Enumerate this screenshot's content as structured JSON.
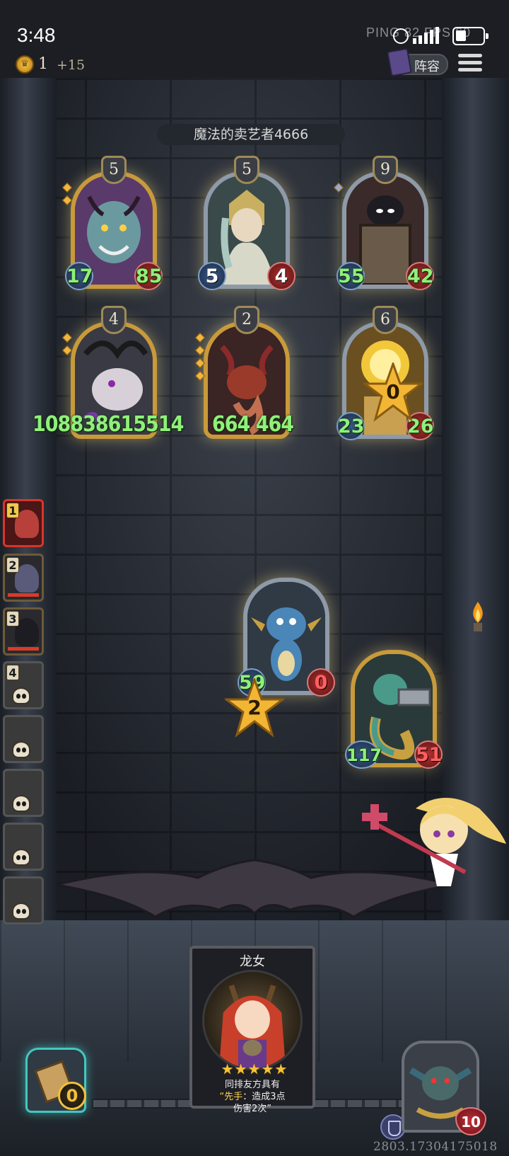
{
  "status_bar": {
    "time": "3:48",
    "ping": "PING 82  FPS 60"
  },
  "top_hud": {
    "coins": "1",
    "coin_income": "+15",
    "lineup_label": "阵容"
  },
  "opponent": {
    "name": "魔法的卖艺者4666"
  },
  "enemy_board": [
    {
      "tier": "5",
      "attack": "17",
      "health": "85",
      "attack_color": "green",
      "health_color": "green",
      "frame": "gold",
      "art": "demon-icon"
    },
    {
      "tier": "5",
      "attack": "5",
      "health": "4",
      "attack_color": "white",
      "health_color": "white",
      "frame": "silver",
      "art": "priest-icon"
    },
    {
      "tier": "9",
      "attack": "55",
      "health": "42",
      "attack_color": "green",
      "health_color": "green",
      "frame": "silver",
      "art": "ghost-knight-icon"
    },
    {
      "tier": "4",
      "stats_text": "108838615514",
      "frame": "gold",
      "art": "horned-dragon-icon"
    },
    {
      "tier": "2",
      "stats_text": "664 464",
      "frame": "gold",
      "art": "red-dragon-icon"
    },
    {
      "tier": "6",
      "attack": "23",
      "health": "26",
      "attack_color": "green",
      "health_color": "green",
      "frame": "silver",
      "art": "sun-golem-icon",
      "badge": "0"
    }
  ],
  "attacking_units": [
    {
      "attack": "59",
      "health": "0",
      "attack_color": "green",
      "health_color": "red",
      "frame": "silver",
      "art": "blue-dragon-icon",
      "damage_badge": "2"
    },
    {
      "attack": "117",
      "health": "51",
      "attack_color": "green",
      "health_color": "red",
      "frame": "gold",
      "art": "naga-gunner-icon"
    }
  ],
  "turn_queue": [
    {
      "num": "1",
      "state": "active"
    },
    {
      "num": "2",
      "state": "alive"
    },
    {
      "num": "3",
      "state": "alive"
    },
    {
      "num": "4",
      "state": "dead"
    },
    {
      "num": "",
      "state": "dead"
    },
    {
      "num": "",
      "state": "dead"
    },
    {
      "num": "",
      "state": "dead"
    },
    {
      "num": "",
      "state": "dead"
    }
  ],
  "hero": {
    "name": "龙女",
    "stars": "★★★★★",
    "desc_line1": "同排友方具有",
    "desc_quote_open": "“",
    "desc_keyword": "先手",
    "desc_line2": "：造成3点",
    "desc_line3": "伤害2次”"
  },
  "shop": {
    "gold": "0"
  },
  "boss": {
    "health": "10"
  },
  "debug_coords": "2803.17304175018",
  "colors": {
    "gold_frame": "#c89a3a",
    "silver_frame": "#8e9aa8",
    "stat_green": "#8ff07a",
    "stat_red": "#ff6060"
  }
}
